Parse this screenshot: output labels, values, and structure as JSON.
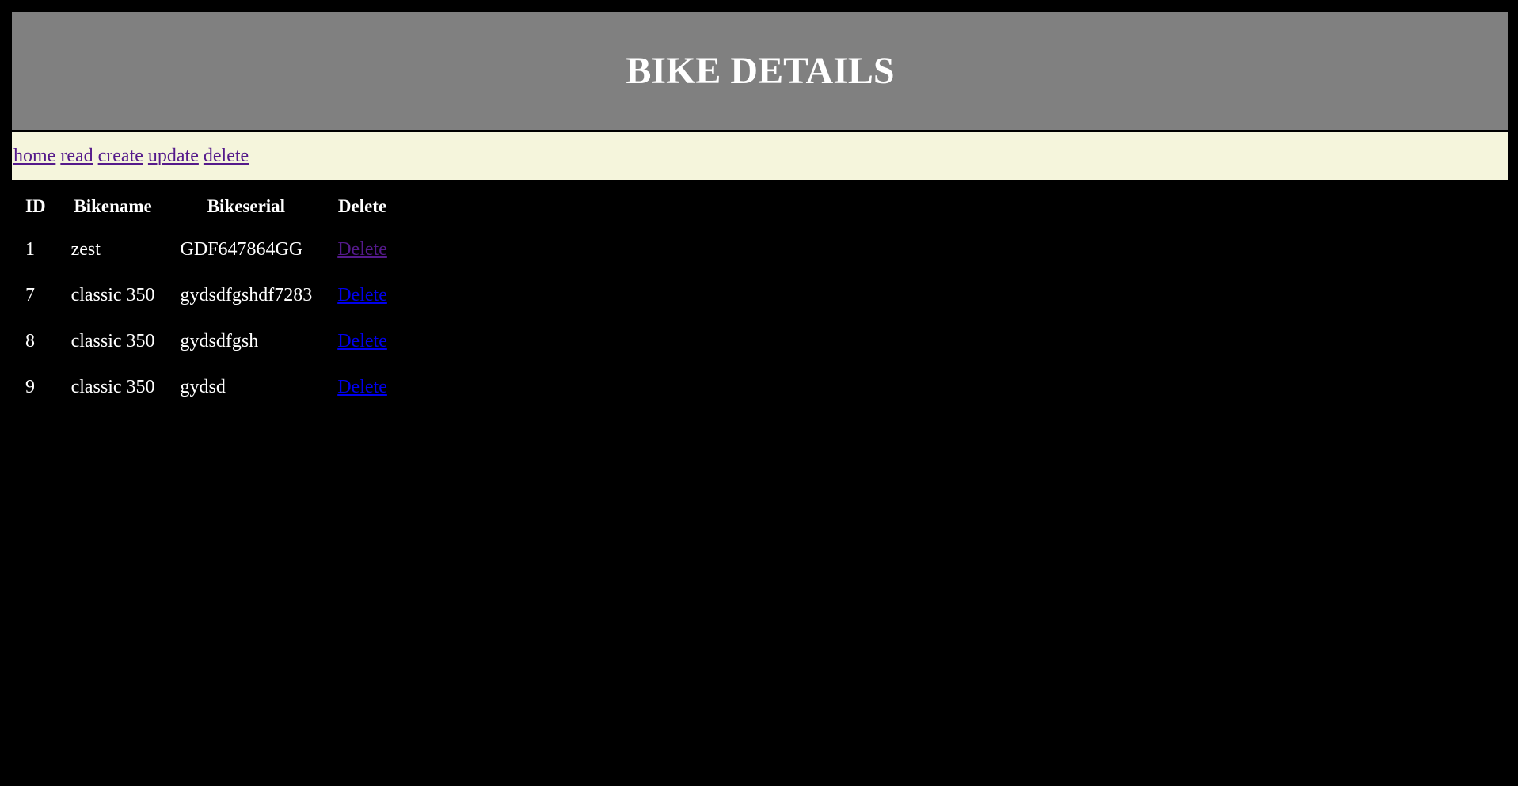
{
  "header": {
    "title": "BIKE DETAILS"
  },
  "nav": {
    "links": [
      {
        "label": "home"
      },
      {
        "label": "read"
      },
      {
        "label": "create"
      },
      {
        "label": "update"
      },
      {
        "label": "delete"
      }
    ]
  },
  "table": {
    "columns": [
      "ID",
      "Bikename",
      "Bikeserial",
      "Delete"
    ],
    "rows": [
      {
        "id": "1",
        "bikename": "zest",
        "bikeserial": "GDF647864GG",
        "delete_label": "Delete"
      },
      {
        "id": "7",
        "bikename": "classic 350",
        "bikeserial": "gydsdfgshdf7283",
        "delete_label": "Delete"
      },
      {
        "id": "8",
        "bikename": "classic 350",
        "bikeserial": "gydsdfgsh",
        "delete_label": "Delete"
      },
      {
        "id": "9",
        "bikename": "classic 350",
        "bikeserial": "gydsd",
        "delete_label": "Delete"
      }
    ]
  },
  "colors": {
    "page_background": "#000000",
    "header_background": "#808080",
    "nav_background": "#f5f5dc",
    "visited_link": "#551a8b",
    "unvisited_link": "#0000ee",
    "text": "#ffffff"
  }
}
